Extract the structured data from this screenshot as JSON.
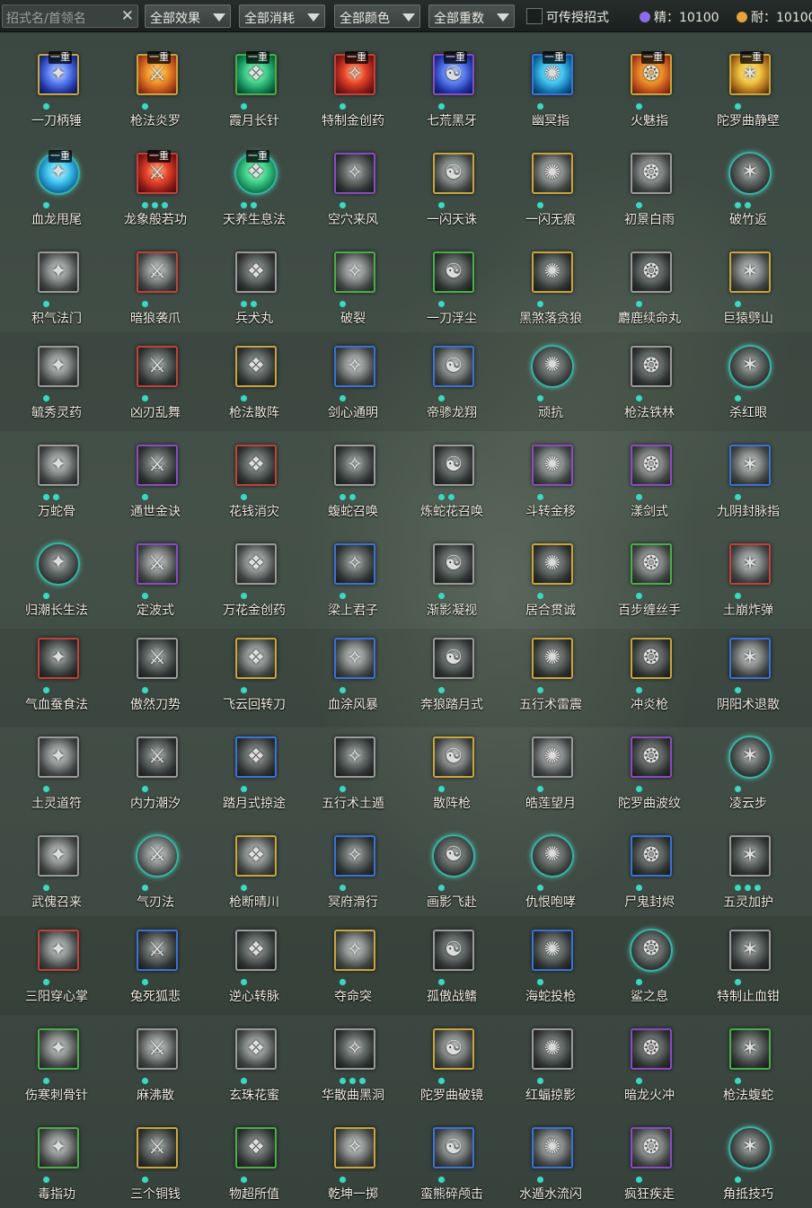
{
  "toolbar": {
    "search_placeholder": "招式名/首领名",
    "filters": [
      "全部效果",
      "全部消耗",
      "全部颜色",
      "全部重数"
    ],
    "checkbox_label": "可传授招式",
    "checkbox_checked": false,
    "essence_label": "精：10100",
    "endurance_label": "耐：10100",
    "essence_color": "#8a6cf0",
    "endurance_color": "#e8a13c"
  },
  "tier_label": "一重",
  "skills": [
    {
      "name": "一刀柄锤",
      "border": "gold",
      "art": "blue",
      "tier": true,
      "dots": 1
    },
    {
      "name": "枪法炎罗",
      "border": "gold",
      "art": "orange",
      "tier": true,
      "dots": 1
    },
    {
      "name": "霞月长针",
      "border": "green",
      "art": "green",
      "tier": true,
      "dots": 1
    },
    {
      "name": "特制金创药",
      "border": "red",
      "art": "red",
      "tier": true,
      "dots": 1
    },
    {
      "name": "七荒黑牙",
      "border": "purple",
      "art": "blue",
      "tier": true,
      "dots": 1
    },
    {
      "name": "幽冥指",
      "border": "blue",
      "art": "cyan",
      "tier": true,
      "dots": 1
    },
    {
      "name": "火魅指",
      "border": "gold",
      "art": "orange",
      "tier": true,
      "dots": 1
    },
    {
      "name": "陀罗曲静壁",
      "border": "gold",
      "art": "gold",
      "tier": true,
      "dots": 1
    },
    {
      "name": "血龙甩尾",
      "border": "teal",
      "art": "cyan",
      "tier": true,
      "dots": 1
    },
    {
      "name": "龙象般若功",
      "border": "red",
      "art": "red",
      "tier": true,
      "dots": 3
    },
    {
      "name": "天养生息法",
      "border": "teal",
      "art": "green",
      "tier": true,
      "dots": 2
    },
    {
      "name": "空穴来风",
      "border": "purple",
      "art": "dark",
      "tier": false,
      "dots": 1
    },
    {
      "name": "一闪天诛",
      "border": "gold",
      "art": "gray",
      "tier": false,
      "dots": 1
    },
    {
      "name": "一闪无痕",
      "border": "gold",
      "art": "gray",
      "tier": false,
      "dots": 1
    },
    {
      "name": "初景白雨",
      "border": "gray",
      "art": "gray",
      "tier": false,
      "dots": 1
    },
    {
      "name": "破竹返",
      "border": "teal",
      "art": "dark",
      "tier": false,
      "dots": 2
    },
    {
      "name": "积气法门",
      "border": "gray",
      "art": "gray",
      "tier": false,
      "dots": 1
    },
    {
      "name": "暗狼袭爪",
      "border": "red",
      "art": "gray",
      "tier": false,
      "dots": 1
    },
    {
      "name": "兵犬丸",
      "border": "gray",
      "art": "dark",
      "tier": false,
      "dots": 2
    },
    {
      "name": "破裂",
      "border": "green",
      "art": "gray",
      "tier": false,
      "dots": 1
    },
    {
      "name": "一刀浮尘",
      "border": "green",
      "art": "dark",
      "tier": false,
      "dots": 1
    },
    {
      "name": "黑煞落贪狼",
      "border": "gold",
      "art": "dark",
      "tier": false,
      "dots": 1
    },
    {
      "name": "麝鹿续命丸",
      "border": "gray",
      "art": "dark",
      "tier": false,
      "dots": 1
    },
    {
      "name": "巨猿劈山",
      "border": "gold",
      "art": "gray",
      "tier": false,
      "dots": 1
    },
    {
      "name": "毓秀灵药",
      "border": "gray",
      "art": "gray",
      "tier": false,
      "dots": 1
    },
    {
      "name": "凶刃乱舞",
      "border": "red",
      "art": "dark",
      "tier": false,
      "dots": 1
    },
    {
      "name": "枪法散阵",
      "border": "gold",
      "art": "dark",
      "tier": false,
      "dots": 1
    },
    {
      "name": "剑心通明",
      "border": "blue",
      "art": "gray",
      "tier": false,
      "dots": 1
    },
    {
      "name": "帝骖龙翔",
      "border": "blue",
      "art": "gray",
      "tier": false,
      "dots": 1
    },
    {
      "name": "顽抗",
      "border": "teal",
      "art": "dark",
      "tier": false,
      "dots": 1
    },
    {
      "name": "枪法铁林",
      "border": "gray",
      "art": "dark",
      "tier": false,
      "dots": 1
    },
    {
      "name": "杀红眼",
      "border": "teal",
      "art": "dark",
      "tier": false,
      "dots": 1
    },
    {
      "name": "万蛇骨",
      "border": "gray",
      "art": "gray",
      "tier": false,
      "dots": 2
    },
    {
      "name": "通世金诀",
      "border": "purple",
      "art": "dark",
      "tier": false,
      "dots": 1
    },
    {
      "name": "花钱消灾",
      "border": "red",
      "art": "dark",
      "tier": false,
      "dots": 1
    },
    {
      "name": "蝮蛇召唤",
      "border": "gray",
      "art": "dark",
      "tier": false,
      "dots": 2
    },
    {
      "name": "炼蛇花召唤",
      "border": "gray",
      "art": "dark",
      "tier": false,
      "dots": 2
    },
    {
      "name": "斗转金移",
      "border": "purple",
      "art": "gray",
      "tier": false,
      "dots": 1
    },
    {
      "name": "漾剑式",
      "border": "purple",
      "art": "gray",
      "tier": false,
      "dots": 1
    },
    {
      "name": "九阴封脉指",
      "border": "blue",
      "art": "gray",
      "tier": false,
      "dots": 1
    },
    {
      "name": "归潮长生法",
      "border": "teal",
      "art": "dark",
      "tier": false,
      "dots": 1
    },
    {
      "name": "定波式",
      "border": "purple",
      "art": "gray",
      "tier": false,
      "dots": 1
    },
    {
      "name": "万花金创药",
      "border": "gray",
      "art": "gray",
      "tier": false,
      "dots": 1
    },
    {
      "name": "梁上君子",
      "border": "blue",
      "art": "dark",
      "tier": false,
      "dots": 1
    },
    {
      "name": "渐影凝视",
      "border": "gray",
      "art": "dark",
      "tier": false,
      "dots": 1
    },
    {
      "name": "居合贯诚",
      "border": "gold",
      "art": "dark",
      "tier": false,
      "dots": 1
    },
    {
      "name": "百步缠丝手",
      "border": "green",
      "art": "gray",
      "tier": false,
      "dots": 1
    },
    {
      "name": "土崩炸弹",
      "border": "red",
      "art": "gray",
      "tier": false,
      "dots": 1
    },
    {
      "name": "气血蚕食法",
      "border": "red",
      "art": "dark",
      "tier": false,
      "dots": 1
    },
    {
      "name": "傲然刀势",
      "border": "gray",
      "art": "dark",
      "tier": false,
      "dots": 1
    },
    {
      "name": "飞云回转刀",
      "border": "gold",
      "art": "gray",
      "tier": false,
      "dots": 1
    },
    {
      "name": "血涂风暴",
      "border": "blue",
      "art": "gray",
      "tier": false,
      "dots": 1
    },
    {
      "name": "奔狼踏月式",
      "border": "gray",
      "art": "dark",
      "tier": false,
      "dots": 1
    },
    {
      "name": "五行术雷震",
      "border": "gold",
      "art": "dark",
      "tier": false,
      "dots": 1
    },
    {
      "name": "冲炎枪",
      "border": "gold",
      "art": "dark",
      "tier": false,
      "dots": 1
    },
    {
      "name": "阴阳术退散",
      "border": "blue",
      "art": "gray",
      "tier": false,
      "dots": 1
    },
    {
      "name": "土灵道符",
      "border": "gray",
      "art": "gray",
      "tier": false,
      "dots": 1
    },
    {
      "name": "内力潮汐",
      "border": "gray",
      "art": "dark",
      "tier": false,
      "dots": 1
    },
    {
      "name": "踏月式掠途",
      "border": "blue",
      "art": "dark",
      "tier": false,
      "dots": 1
    },
    {
      "name": "五行术土遁",
      "border": "gray",
      "art": "dark",
      "tier": false,
      "dots": 1
    },
    {
      "name": "散阵枪",
      "border": "gold",
      "art": "gray",
      "tier": false,
      "dots": 1
    },
    {
      "name": "皓莲望月",
      "border": "gray",
      "art": "gray",
      "tier": false,
      "dots": 1
    },
    {
      "name": "陀罗曲波纹",
      "border": "purple",
      "art": "dark",
      "tier": false,
      "dots": 1
    },
    {
      "name": "凌云步",
      "border": "teal",
      "art": "dark",
      "tier": false,
      "dots": 1
    },
    {
      "name": "武傀召来",
      "border": "gray",
      "art": "gray",
      "tier": false,
      "dots": 1
    },
    {
      "name": "气刃法",
      "border": "teal",
      "art": "gray",
      "tier": false,
      "dots": 1
    },
    {
      "name": "枪断晴川",
      "border": "gold",
      "art": "gray",
      "tier": false,
      "dots": 1
    },
    {
      "name": "冥府滑行",
      "border": "blue",
      "art": "dark",
      "tier": false,
      "dots": 1
    },
    {
      "name": "画影飞赴",
      "border": "teal",
      "art": "dark",
      "tier": false,
      "dots": 1
    },
    {
      "name": "仇恨咆哮",
      "border": "teal",
      "art": "dark",
      "tier": false,
      "dots": 1
    },
    {
      "name": "尸鬼封烬",
      "border": "blue",
      "art": "dark",
      "tier": false,
      "dots": 1
    },
    {
      "name": "五灵加护",
      "border": "gray",
      "art": "dark",
      "tier": false,
      "dots": 3
    },
    {
      "name": "三阳穿心掌",
      "border": "red",
      "art": "gray",
      "tier": false,
      "dots": 1
    },
    {
      "name": "兔死狐悲",
      "border": "blue",
      "art": "dark",
      "tier": false,
      "dots": 1
    },
    {
      "name": "逆心转脉",
      "border": "gray",
      "art": "dark",
      "tier": false,
      "dots": 1
    },
    {
      "name": "夺命突",
      "border": "gold",
      "art": "gray",
      "tier": false,
      "dots": 1
    },
    {
      "name": "孤傲战鳍",
      "border": "gray",
      "art": "dark",
      "tier": false,
      "dots": 1
    },
    {
      "name": "海蛇投枪",
      "border": "blue",
      "art": "dark",
      "tier": false,
      "dots": 1
    },
    {
      "name": "鲨之息",
      "border": "teal",
      "art": "dark",
      "tier": false,
      "dots": 1
    },
    {
      "name": "特制止血钳",
      "border": "gray",
      "art": "dark",
      "tier": false,
      "dots": 1
    },
    {
      "name": "伤寒刺骨针",
      "border": "green",
      "art": "gray",
      "tier": false,
      "dots": 1
    },
    {
      "name": "麻沸散",
      "border": "gray",
      "art": "gray",
      "tier": false,
      "dots": 1
    },
    {
      "name": "玄珠花蜜",
      "border": "gray",
      "art": "gray",
      "tier": false,
      "dots": 1
    },
    {
      "name": "华散曲黑洞",
      "border": "gray",
      "art": "dark",
      "tier": false,
      "dots": 3
    },
    {
      "name": "陀罗曲破镜",
      "border": "gold",
      "art": "gray",
      "tier": false,
      "dots": 1
    },
    {
      "name": "红蝠掠影",
      "border": "gray",
      "art": "dark",
      "tier": false,
      "dots": 1
    },
    {
      "name": "暗龙火冲",
      "border": "purple",
      "art": "dark",
      "tier": false,
      "dots": 1
    },
    {
      "name": "枪法蝮蛇",
      "border": "green",
      "art": "dark",
      "tier": false,
      "dots": 1
    },
    {
      "name": "毒指功",
      "border": "green",
      "art": "gray",
      "tier": false,
      "dots": 1
    },
    {
      "name": "三个铜钱",
      "border": "gold",
      "art": "dark",
      "tier": false,
      "dots": 1
    },
    {
      "name": "物超所值",
      "border": "green",
      "art": "dark",
      "tier": false,
      "dots": 1
    },
    {
      "name": "乾坤一掷",
      "border": "gold",
      "art": "gray",
      "tier": false,
      "dots": 1
    },
    {
      "name": "蛮熊碎颅击",
      "border": "blue",
      "art": "gray",
      "tier": false,
      "dots": 1
    },
    {
      "name": "水遁水流闪",
      "border": "blue",
      "art": "gray",
      "tier": false,
      "dots": 1
    },
    {
      "name": "疯狂疾走",
      "border": "purple",
      "art": "gray",
      "tier": false,
      "dots": 1
    },
    {
      "name": "角抵技巧",
      "border": "teal",
      "art": "dark",
      "tier": false,
      "dots": 1
    }
  ]
}
